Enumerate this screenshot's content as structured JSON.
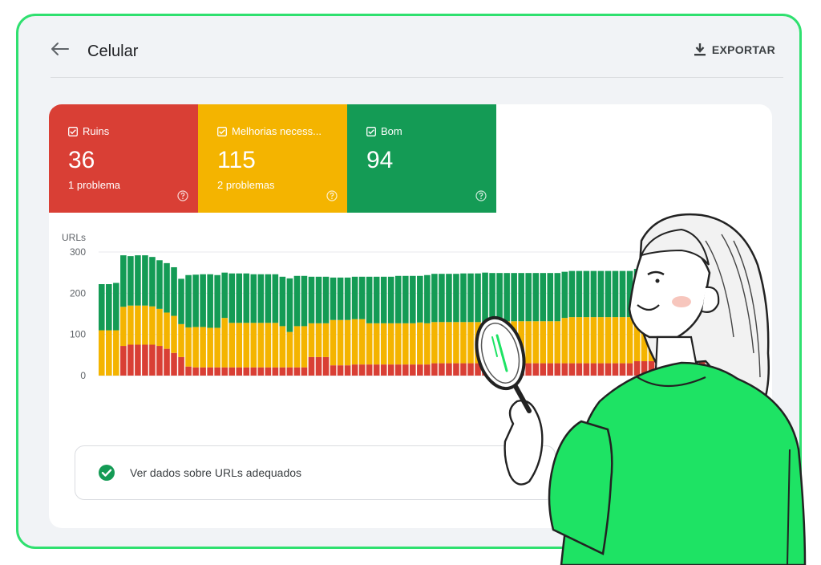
{
  "header": {
    "title": "Celular",
    "export_label": "EXPORTAR"
  },
  "tiles": [
    {
      "label": "Ruins",
      "count": "36",
      "problems": "1 problema",
      "color": "#d93f35"
    },
    {
      "label": "Melhorias necess...",
      "count": "115",
      "problems": "2 problemas",
      "color": "#f4b400"
    },
    {
      "label": "Bom",
      "count": "94",
      "problems": "",
      "color": "#149b55"
    }
  ],
  "chart_data": {
    "type": "bar",
    "stacked": true,
    "ylabel": "URLs",
    "ylim": [
      0,
      300
    ],
    "yticks": [
      300,
      200,
      100,
      0
    ],
    "grid": true,
    "colors": {
      "Ruins": "#d93f35",
      "Melhorias": "#f4b400",
      "Bom": "#149b55"
    },
    "series": [
      {
        "name": "Ruins",
        "values": [
          0,
          0,
          0,
          72,
          75,
          75,
          75,
          75,
          72,
          65,
          55,
          45,
          22,
          20,
          20,
          20,
          20,
          20,
          20,
          20,
          20,
          20,
          20,
          20,
          20,
          20,
          20,
          20,
          20,
          45,
          45,
          45,
          25,
          25,
          25,
          27,
          27,
          27,
          27,
          27,
          27,
          27,
          27,
          27,
          27,
          27,
          30,
          30,
          30,
          30,
          30,
          30,
          30,
          30,
          30,
          30,
          30,
          30,
          30,
          30,
          30,
          30,
          30,
          30,
          30,
          30,
          30,
          30,
          30,
          30,
          30,
          30,
          30,
          30,
          35,
          35,
          35,
          35,
          60,
          35,
          35,
          35,
          35,
          35
        ]
      },
      {
        "name": "Melhorias",
        "values": [
          110,
          110,
          110,
          95,
          95,
          95,
          95,
          93,
          90,
          88,
          90,
          80,
          95,
          98,
          98,
          96,
          96,
          120,
          108,
          108,
          108,
          108,
          108,
          108,
          108,
          100,
          86,
          100,
          100,
          82,
          82,
          82,
          110,
          110,
          110,
          110,
          110,
          100,
          100,
          100,
          100,
          100,
          100,
          100,
          102,
          100,
          100,
          100,
          100,
          100,
          100,
          100,
          100,
          100,
          102,
          102,
          102,
          102,
          102,
          102,
          102,
          102,
          102,
          102,
          110,
          112,
          112,
          112,
          112,
          112,
          112,
          112,
          112,
          112,
          112,
          112,
          112,
          112,
          112,
          112,
          112,
          112,
          112,
          112
        ]
      },
      {
        "name": "Bom",
        "values": [
          112,
          112,
          115,
          125,
          120,
          122,
          122,
          120,
          118,
          120,
          118,
          110,
          127,
          127,
          128,
          130,
          128,
          110,
          120,
          120,
          120,
          118,
          118,
          118,
          118,
          120,
          130,
          122,
          122,
          113,
          113,
          113,
          103,
          103,
          103,
          103,
          103,
          113,
          113,
          113,
          113,
          115,
          115,
          115,
          113,
          117,
          117,
          117,
          117,
          117,
          118,
          118,
          118,
          120,
          117,
          117,
          117,
          117,
          117,
          117,
          117,
          117,
          117,
          117,
          112,
          112,
          112,
          112,
          112,
          112,
          112,
          112,
          112,
          112,
          112,
          112,
          112,
          112,
          112,
          112,
          112,
          112,
          112,
          112
        ]
      }
    ]
  },
  "good_urls_link": "Ver dados sobre URLs adequados"
}
